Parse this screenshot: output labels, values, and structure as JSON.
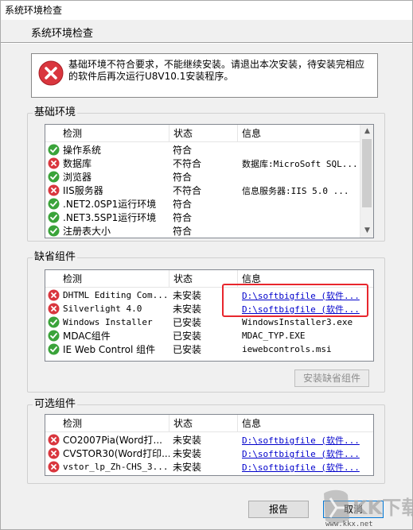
{
  "window": {
    "title": "系统环境检查"
  },
  "header": {
    "subtitle": "系统环境检查"
  },
  "message": {
    "text": "基础环境不符合要求，不能继续安装。请退出本次安装，待安装完相应的软件后再次运行U8V10.1安装程序。"
  },
  "columns": {
    "check": "检测",
    "status": "状态",
    "info": "信息"
  },
  "basic_env": {
    "title": "基础环境",
    "rows": [
      {
        "ok": true,
        "name": "操作系统",
        "status": "符合",
        "info": ""
      },
      {
        "ok": false,
        "name": "数据库",
        "status": "不符合",
        "info": "数据库:MicroSoft SQL..."
      },
      {
        "ok": true,
        "name": "浏览器",
        "status": "符合",
        "info": ""
      },
      {
        "ok": false,
        "name": "IIS服务器",
        "status": "不符合",
        "info": "信息服务器:IIS 5.0 ..."
      },
      {
        "ok": true,
        "name": ".NET2.0SP1运行环境",
        "status": "符合",
        "info": ""
      },
      {
        "ok": true,
        "name": ".NET3.5SP1运行环境",
        "status": "符合",
        "info": ""
      },
      {
        "ok": true,
        "name": "注册表大小",
        "status": "符合",
        "info": ""
      }
    ]
  },
  "default_components": {
    "title": "缺省组件",
    "rows": [
      {
        "ok": false,
        "name": "DHTML Editing Com...",
        "status": "未安装",
        "info": "D:\\softbigfile (软件...",
        "link": true
      },
      {
        "ok": false,
        "name": "Silverlight 4.0",
        "status": "未安装",
        "info": "D:\\softbigfile (软件...",
        "link": true
      },
      {
        "ok": true,
        "name": "Windows Installer",
        "status": "已安装",
        "info": "WindowsInstaller3.exe",
        "link": false
      },
      {
        "ok": true,
        "name": "MDAC组件",
        "status": "已安装",
        "info": "MDAC_TYP.EXE",
        "link": false
      },
      {
        "ok": true,
        "name": "IE Web Control 组件",
        "status": "已安装",
        "info": "iewebcontrols.msi",
        "link": false
      }
    ],
    "install_button": "安装缺省组件"
  },
  "optional_components": {
    "title": "可选组件",
    "rows": [
      {
        "ok": false,
        "name": "CO2007Pia(Word打...",
        "status": "未安装",
        "info": "D:\\softbigfile (软件...",
        "link": true
      },
      {
        "ok": false,
        "name": "CVSTOR30(Word打印...",
        "status": "未安装",
        "info": "D:\\softbigfile (软件...",
        "link": true
      },
      {
        "ok": false,
        "name": "vstor_lp_Zh-CHS_3...",
        "status": "未安装",
        "info": "D:\\softbigfile (软件...",
        "link": true
      }
    ]
  },
  "buttons": {
    "report": "报告",
    "cancel": "取消"
  },
  "watermark": {
    "logo": "KK下载",
    "url": "www.kkx.net"
  },
  "colors": {
    "ok": "#3aa33a",
    "error": "#d9363e",
    "highlight": "#e8262d",
    "link": "#0000cc"
  }
}
